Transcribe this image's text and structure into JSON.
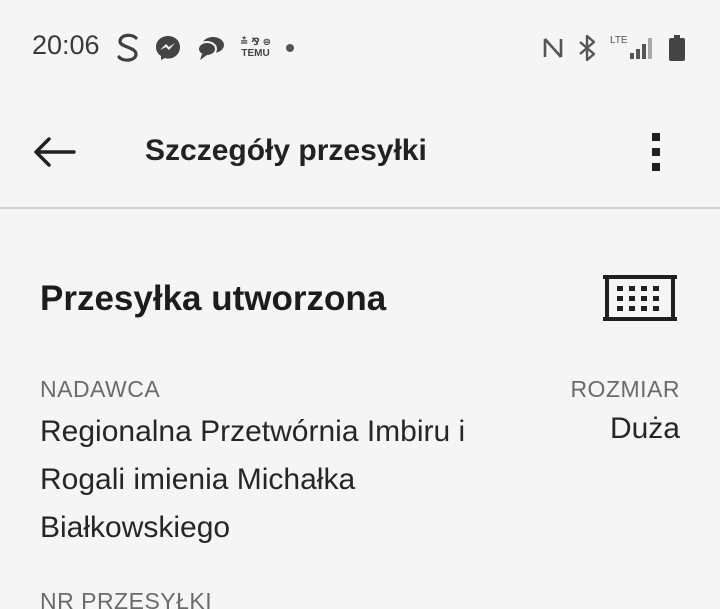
{
  "status_bar": {
    "time": "20:06",
    "left_icons": [
      "s-app-icon",
      "messenger-icon",
      "chat-bubble-icon",
      "temu-icon",
      "notification-dot-icon"
    ],
    "right_icons": [
      "nfc-icon",
      "bluetooth-icon",
      "lte-signal-icon",
      "battery-icon"
    ],
    "temu_top": "≛ ⅋ ⊜",
    "temu_label": "TEMU",
    "lte_label": "LTE"
  },
  "app_bar": {
    "title": "Szczegóły przesyłki",
    "back_icon": "arrow-left-icon",
    "more_icon": "more-vert-icon"
  },
  "shipment": {
    "status_heading": "Przesyłka utworzona",
    "size_icon": "parcel-size-large-icon",
    "sender_label": "NADAWCA",
    "sender_value": "Regionalna Przetwórnia Imbiru i Rogali imienia Michałka Białkowskiego",
    "size_label": "ROZMIAR",
    "size_value": "Duża",
    "tracking_label": "NR PRZESYŁKI"
  },
  "colors": {
    "background": "#f5f5f5",
    "text": "#1f1f1f",
    "label": "#6b6b6b",
    "divider": "#cfcfcf"
  }
}
